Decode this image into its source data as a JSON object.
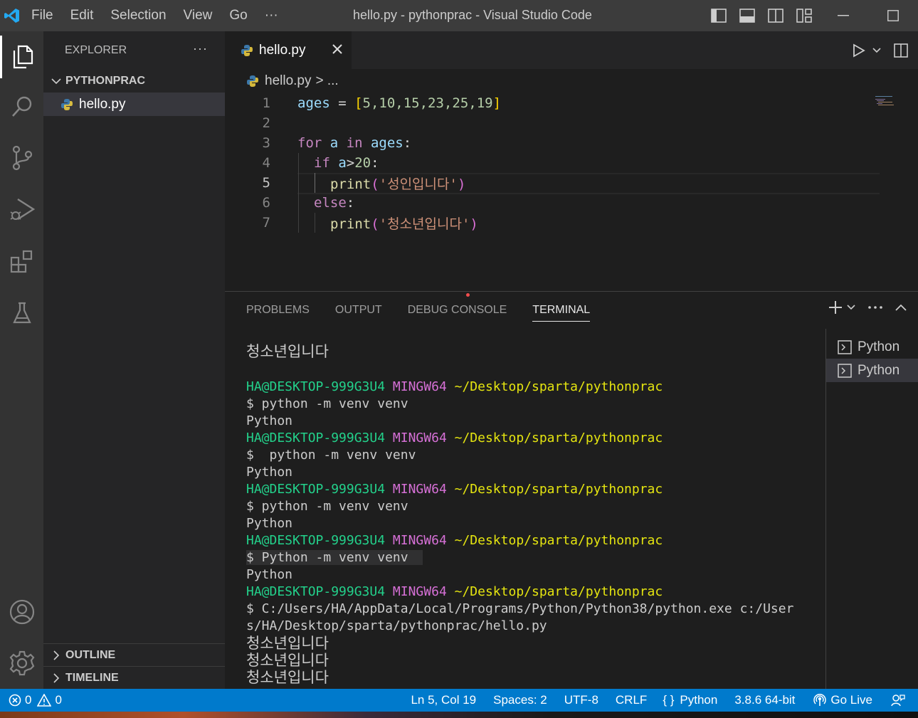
{
  "titlebar": {
    "menu": [
      "File",
      "Edit",
      "Selection",
      "View",
      "Go",
      "···"
    ],
    "window_title": "hello.py - pythonprac - Visual Studio Code"
  },
  "sidebar": {
    "header": "EXPLORER",
    "more": "···",
    "folder": "PYTHONPRAC",
    "file": "hello.py",
    "outline": "OUTLINE",
    "timeline": "TIMELINE"
  },
  "editor": {
    "tab_label": "hello.py",
    "breadcrumb_file": "hello.py",
    "breadcrumb_rest": "> ...",
    "line_numbers": [
      "1",
      "2",
      "3",
      "4",
      "5",
      "6",
      "7"
    ],
    "code": {
      "l1_var": "ages",
      "l1_op": " = ",
      "l1_open": "[",
      "l1_nums": "5,10,15,23,25,19",
      "l1_close": "]",
      "l3_for": "for",
      "l3_a": " a ",
      "l3_in": "in",
      "l3_ages": " ages",
      "l3_colon": ":",
      "l4_if": "if",
      "l4_cond": " a",
      "l4_gt": ">",
      "l4_num": "20",
      "l4_colon": ":",
      "l5_print": "print",
      "l5_str": "'성인입니다'",
      "l6_else": "else",
      "l6_colon": ":",
      "l7_print": "print",
      "l7_str": "'청소년입니다'",
      "paren_open": "(",
      "paren_close": ")"
    }
  },
  "panel": {
    "tabs": [
      "PROBLEMS",
      "OUTPUT",
      "DEBUG CONSOLE",
      "TERMINAL"
    ],
    "active_tab": "TERMINAL",
    "terminals": [
      "Python",
      "Python"
    ],
    "prompt_user": "HA@DESKTOP-999G3U4",
    "prompt_env": "MINGW64",
    "prompt_path": "~/Desktop/sparta/pythonprac",
    "output_top": "청소년입니다",
    "cmd1": "$ python -m venv venv",
    "cmd2": "$  python -m venv venv",
    "cmd3": "$ python -m venv venv",
    "cmd4": "$ Python -m venv venv",
    "python_out": "Python",
    "cmd5_a": "$ C:/Users/HA/AppData/Local/Programs/Python/Python38/python.exe c:/User",
    "cmd5_b": "s/HA/Desktop/sparta/pythonprac/hello.py",
    "result": [
      "청소년입니다",
      "청소년입니다",
      "청소년입니다"
    ]
  },
  "statusbar": {
    "errors": "0",
    "warnings": "0",
    "position": "Ln 5, Col 19",
    "spaces": "Spaces: 2",
    "encoding": "UTF-8",
    "eol": "CRLF",
    "language": "Python",
    "interpreter": "3.8.6 64-bit",
    "go_live": "Go Live"
  },
  "colors": {
    "accent": "#007acc",
    "prompt_green": "#23d18b",
    "prompt_purple": "#d670d6",
    "prompt_yellow": "#e5e510"
  }
}
